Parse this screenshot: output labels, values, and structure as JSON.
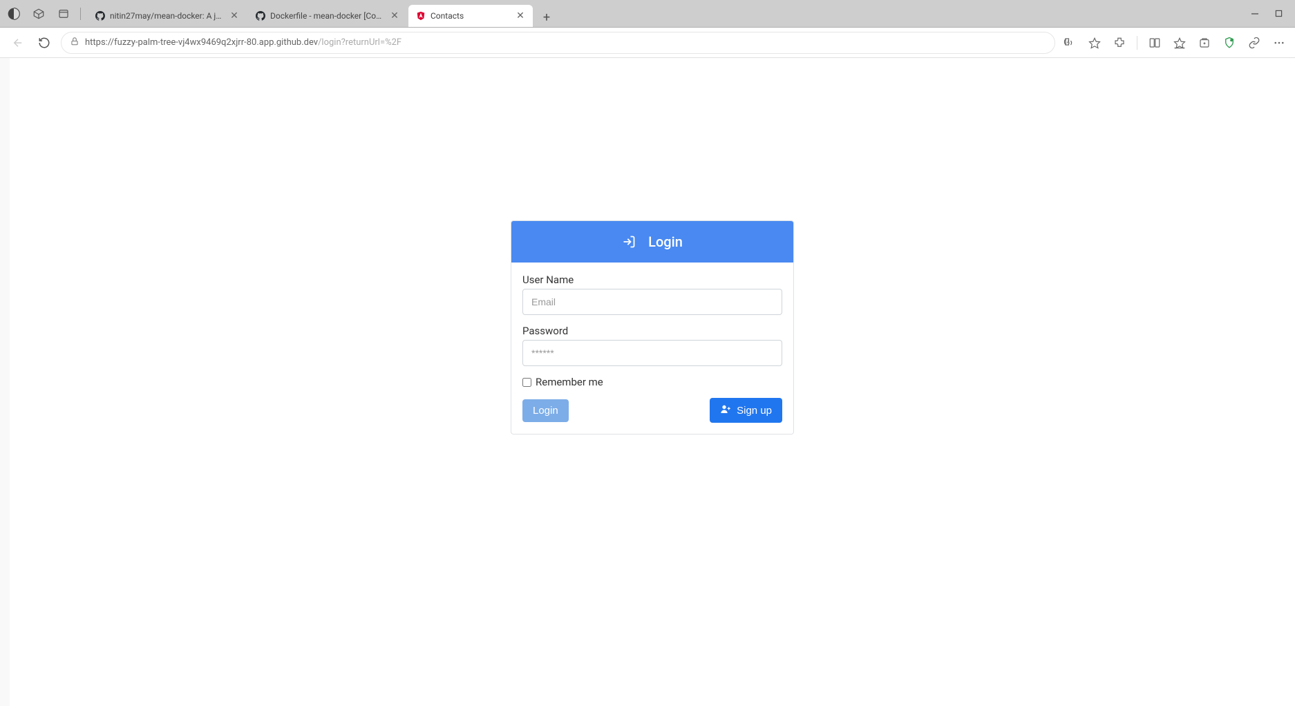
{
  "browser": {
    "tabs": [
      {
        "title": "nitin27may/mean-docker: A jum…",
        "favicon": "github"
      },
      {
        "title": "Dockerfile - mean-docker [Code…",
        "favicon": "github"
      },
      {
        "title": "Contacts",
        "favicon": "app",
        "active": true
      }
    ],
    "url_host": "https://fuzzy-palm-tree-vj4wx9469q2xjrr-80.app.github.dev",
    "url_path": "/login?returnUrl=%2F"
  },
  "login": {
    "header_title": "Login",
    "username_label": "User Name",
    "username_placeholder": "Email",
    "password_label": "Password",
    "password_placeholder": "******",
    "remember_label": "Remember me",
    "login_button": "Login",
    "signup_button": "Sign up"
  }
}
